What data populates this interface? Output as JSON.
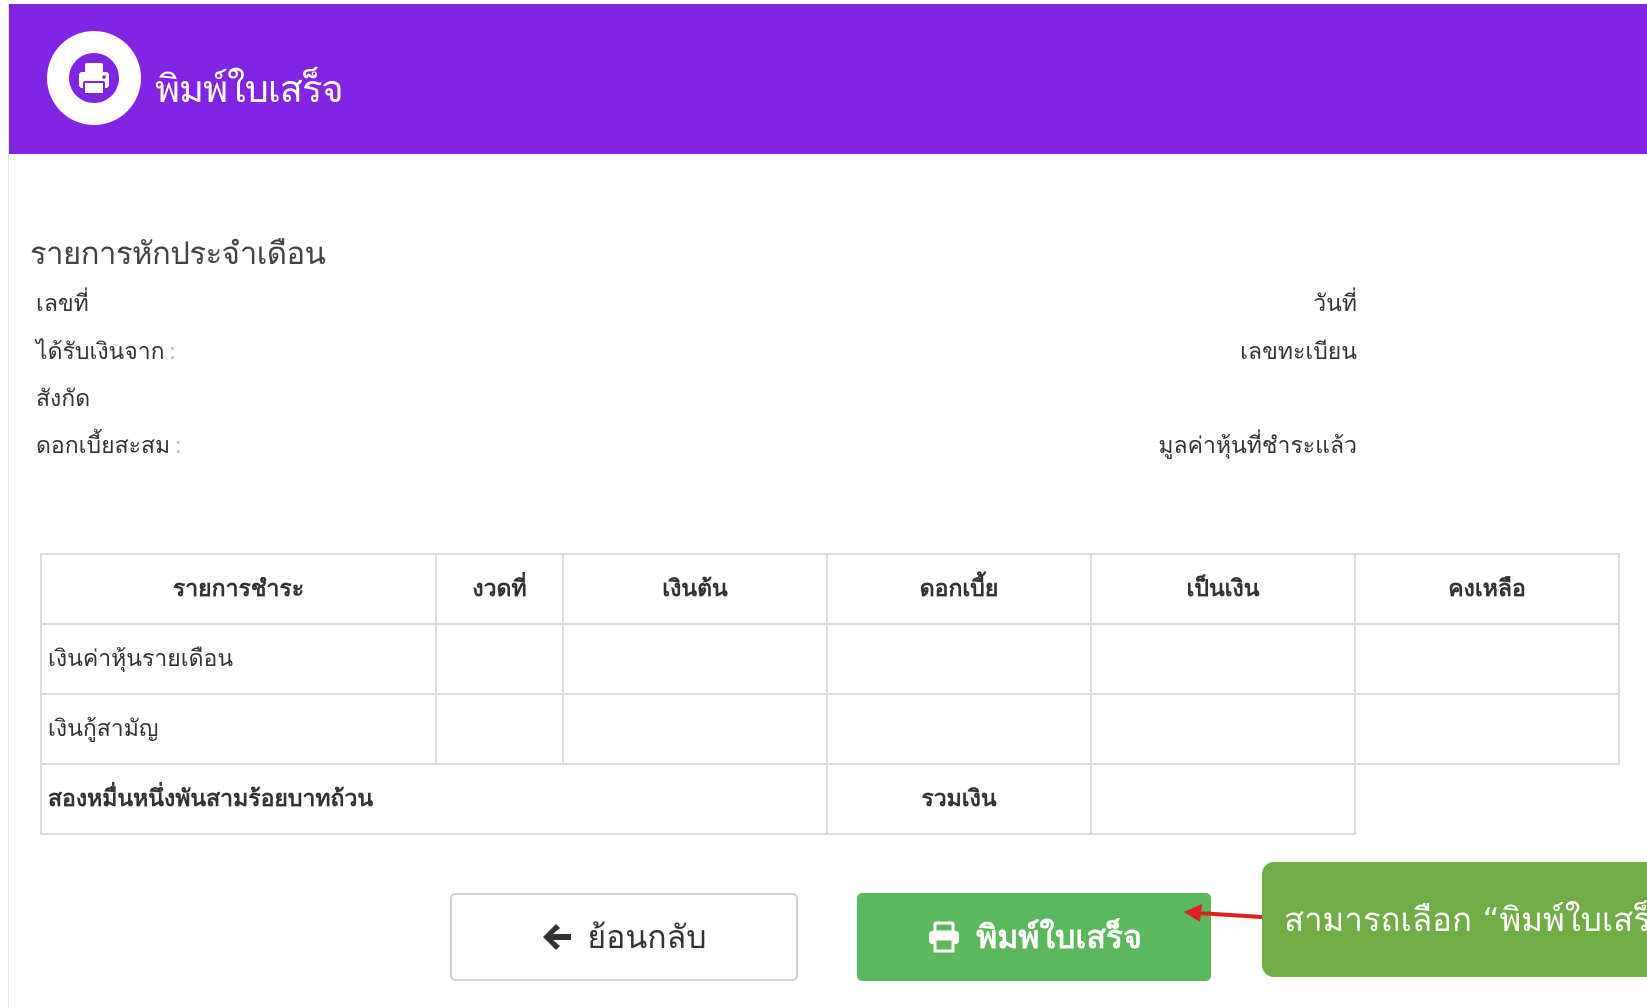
{
  "header": {
    "title": "พิมพ์ใบเสร็จ",
    "icon": "print-icon",
    "color": "#8224e3"
  },
  "section_title": "รายการหักประจำเดือน",
  "info": {
    "receipt_no_label": "เลขที่",
    "date_label": "วันที่",
    "received_from_label": "ได้รับเงินจาก",
    "received_from_sep": ":",
    "register_no_label": "เลขทะเบียน",
    "affiliation_label": "สังกัด",
    "accum_interest_label": "ดอกเบี้ยสะสม",
    "accum_interest_sep": ":",
    "paid_share_value_label": "มูลค่าหุ้นที่ชำระแล้ว"
  },
  "table": {
    "columns": [
      "รายการชำระ",
      "งวดที่",
      "เงินต้น",
      "ดอกเบี้ย",
      "เป็นเงิน",
      "คงเหลือ"
    ],
    "rows": [
      [
        "เงินค่าหุ้นรายเดือน",
        "",
        "",
        "",
        "",
        ""
      ],
      [
        "เงินกู้สามัญ",
        "",
        "",
        "",
        "",
        ""
      ]
    ],
    "total_text": "สองหมื่นหนึ่งพันสามร้อยบาทถ้วน",
    "total_label": "รวมเงิน",
    "total_value": ""
  },
  "buttons": {
    "back_label": "ย้อนกลับ",
    "back_icon": "arrow-left-icon",
    "print_label": "พิมพ์ใบเสร็จ",
    "print_icon": "print-icon",
    "print_color": "#5cb85c"
  },
  "callout": {
    "text": "สามารถเลือก “พิมพ์ใบเสร็จ",
    "color": "#70ad47",
    "arrow_color": "#e02020"
  }
}
